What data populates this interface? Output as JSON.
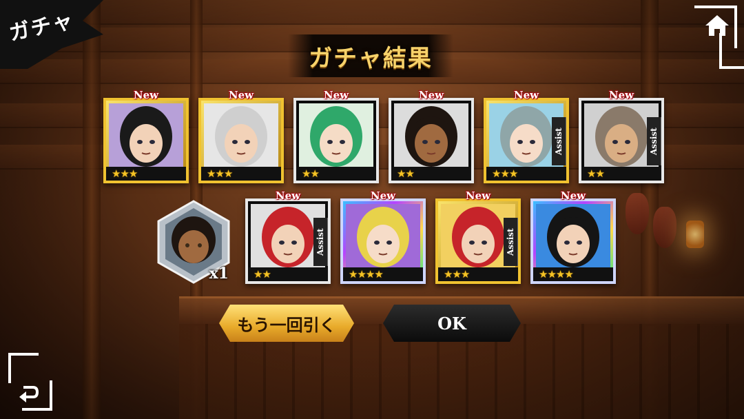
{
  "header": {
    "corner_title": "ガチャ",
    "page_title": "ガチャ結果"
  },
  "results_row1": [
    {
      "badge": "New",
      "stars": "★★★",
      "frame": "gold",
      "assist": "",
      "hair": "#1a1a1a",
      "skin": "#f2d2b8",
      "accent": "#b7a0d8"
    },
    {
      "badge": "New",
      "stars": "★★★",
      "frame": "gold",
      "assist": "",
      "hair": "#cfcfcf",
      "skin": "#f2d2b8",
      "accent": "#e6e6e6"
    },
    {
      "badge": "New",
      "stars": "★★",
      "frame": "silver",
      "assist": "",
      "hair": "#2fa86a",
      "skin": "#f5dcc6",
      "accent": "#e0f0e0"
    },
    {
      "badge": "New",
      "stars": "★★",
      "frame": "silver",
      "assist": "",
      "hair": "#1e1510",
      "skin": "#a06a40",
      "accent": "#dcdcdc"
    },
    {
      "badge": "New",
      "stars": "★★★",
      "frame": "gold",
      "assist": "Assist",
      "hair": "#8fa6a8",
      "skin": "#f6dcc8",
      "accent": "#9ad2e6"
    },
    {
      "badge": "New",
      "stars": "★★",
      "frame": "silver",
      "assist": "Assist",
      "hair": "#8a7a6a",
      "skin": "#d9ae84",
      "accent": "#d0d0d0"
    }
  ],
  "duplicate": {
    "count": "x1",
    "hair": "#1e1510",
    "skin": "#a06a40"
  },
  "results_row2": [
    {
      "badge": "New",
      "stars": "★★",
      "frame": "silver",
      "assist": "Assist",
      "hair": "#c6242a",
      "skin": "#f2d2b8",
      "accent": "#e0e0e0"
    },
    {
      "badge": "New",
      "stars": "★★★★",
      "frame": "rainbow",
      "assist": "",
      "hair": "#e8d24a",
      "skin": "#f6dcc8",
      "accent": "#a06ad8"
    },
    {
      "badge": "New",
      "stars": "★★★",
      "frame": "gold",
      "assist": "Assist",
      "hair": "#c6242a",
      "skin": "#f2d2b8",
      "accent": "#f2d060"
    },
    {
      "badge": "New",
      "stars": "★★★★",
      "frame": "rainbow",
      "assist": "",
      "hair": "#151515",
      "skin": "#f2d2b8",
      "accent": "#3a8ae0"
    }
  ],
  "buttons": {
    "again_label": "もう一回引く",
    "ok_label": "OK"
  },
  "icons": {
    "home": "home-icon",
    "back": "back-arrow-icon"
  },
  "colors": {
    "title_gold": "#f7d26a",
    "button_gold": "#e8aa2a",
    "star": "#f5c325",
    "new_red": "#c0101a"
  }
}
